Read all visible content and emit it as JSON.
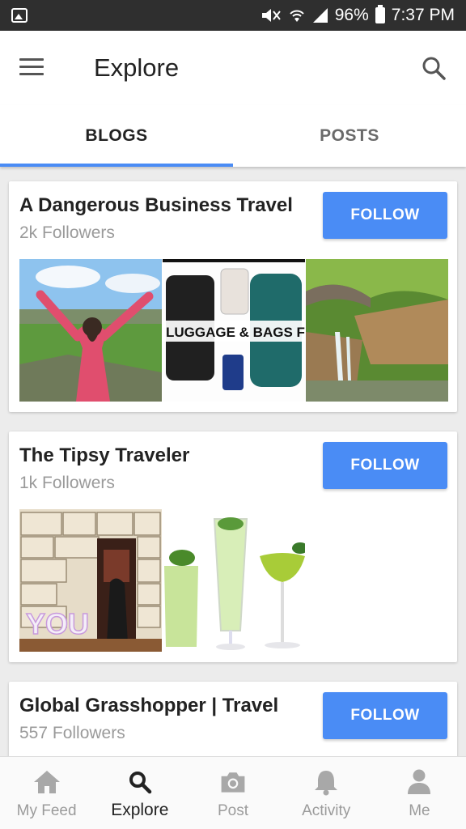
{
  "status_bar": {
    "battery": "96%",
    "time": "7:37 PM",
    "icons": [
      "photo-icon",
      "mute-icon",
      "wifi-icon",
      "signal-icon",
      "battery-icon"
    ]
  },
  "app_bar": {
    "title": "Explore",
    "icons": [
      "menu-icon",
      "search-icon"
    ]
  },
  "tabs": [
    {
      "label": "BLOGS",
      "active": true
    },
    {
      "label": "POSTS",
      "active": false
    }
  ],
  "blogs": [
    {
      "title": "A Dangerous Business Travel",
      "followers": "2k Followers",
      "follow_label": "FOLLOW",
      "thumbnails": [
        "hiker-cliffs",
        "luggage-and-bags",
        "waterfall-gorge"
      ],
      "thumb_caption": "LUGGAGE & BAGS FOR TRA"
    },
    {
      "title": "The Tipsy Traveler",
      "followers": "1k Followers",
      "follow_label": "FOLLOW",
      "thumbnails": [
        "suitcase-wall-door",
        "green-cocktails"
      ],
      "thumb_caption": "YOU"
    },
    {
      "title": "Global Grasshopper | Travel",
      "followers": "557 Followers",
      "follow_label": "FOLLOW",
      "thumbnails": []
    }
  ],
  "bottom_nav": [
    {
      "label": "My Feed",
      "icon": "home-icon",
      "active": false
    },
    {
      "label": "Explore",
      "icon": "search-icon",
      "active": true
    },
    {
      "label": "Post",
      "icon": "camera-icon",
      "active": false
    },
    {
      "label": "Activity",
      "icon": "bell-icon",
      "active": false
    },
    {
      "label": "Me",
      "icon": "person-icon",
      "active": false
    }
  ],
  "colors": {
    "accent": "#4a8cf5",
    "status_bar": "#2f2f2f",
    "background": "#ececec"
  }
}
